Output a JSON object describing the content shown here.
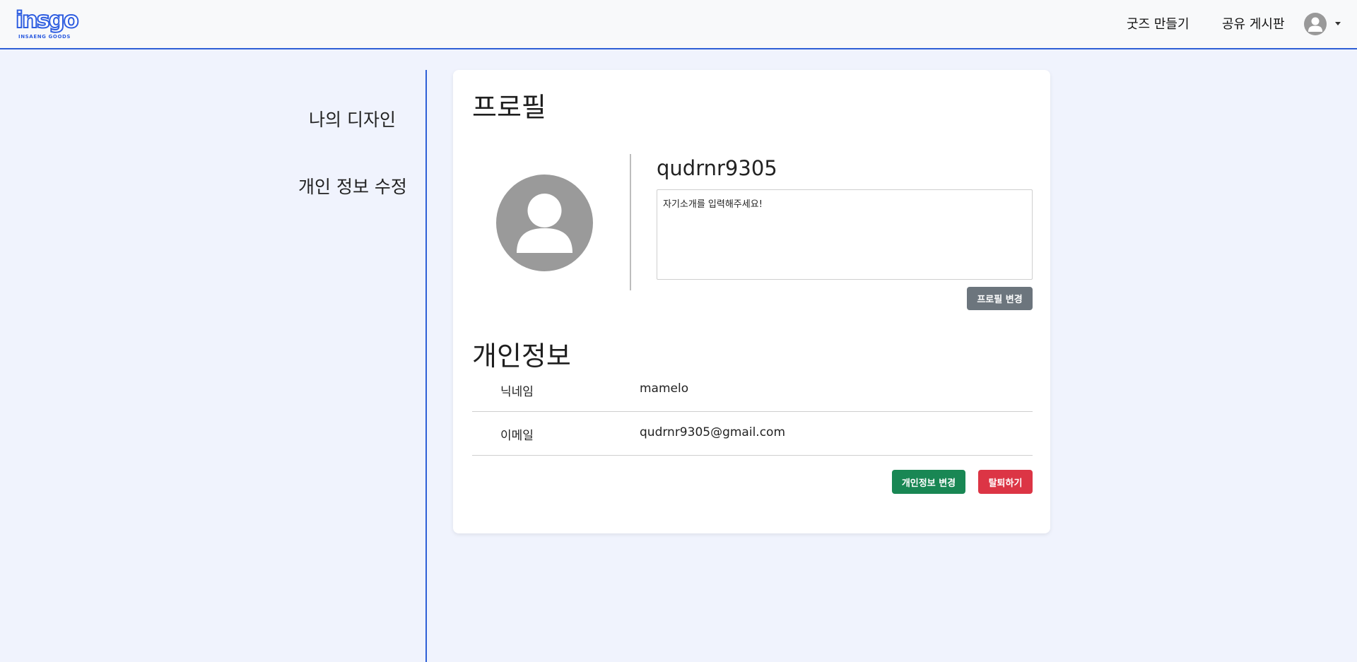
{
  "header": {
    "logo_text": "insgo",
    "logo_subtext": "INSAENG GOODS",
    "nav": {
      "make_goods": "굿즈 만들기",
      "share_board": "공유 게시판"
    },
    "avatar_icon": "user-avatar-icon",
    "caret_icon": "caret-down-icon"
  },
  "sidebar": {
    "items": [
      {
        "label": "나의 디자인"
      },
      {
        "label": "개인 정보 수정"
      }
    ],
    "divider_color": "#2e5fd6"
  },
  "profile": {
    "title": "프로필",
    "avatar_icon": "user-avatar-icon",
    "username": "qudrnr9305",
    "bio_placeholder": "자기소개를 입력해주세요!",
    "change_button": "프로필 변경"
  },
  "personal_info": {
    "title": "개인정보",
    "rows": [
      {
        "label": "닉네임",
        "value": "mamelo"
      },
      {
        "label": "이메일",
        "value": "qudrnr9305@gmail.com"
      }
    ],
    "edit_button": "개인정보 변경",
    "leave_button": "탈퇴하기"
  },
  "colors": {
    "accent": "#2e5fd6",
    "background": "#f0f3fd",
    "edit_button": "#198754",
    "leave_button": "#dc3545",
    "profile_button": "#6c757d"
  }
}
